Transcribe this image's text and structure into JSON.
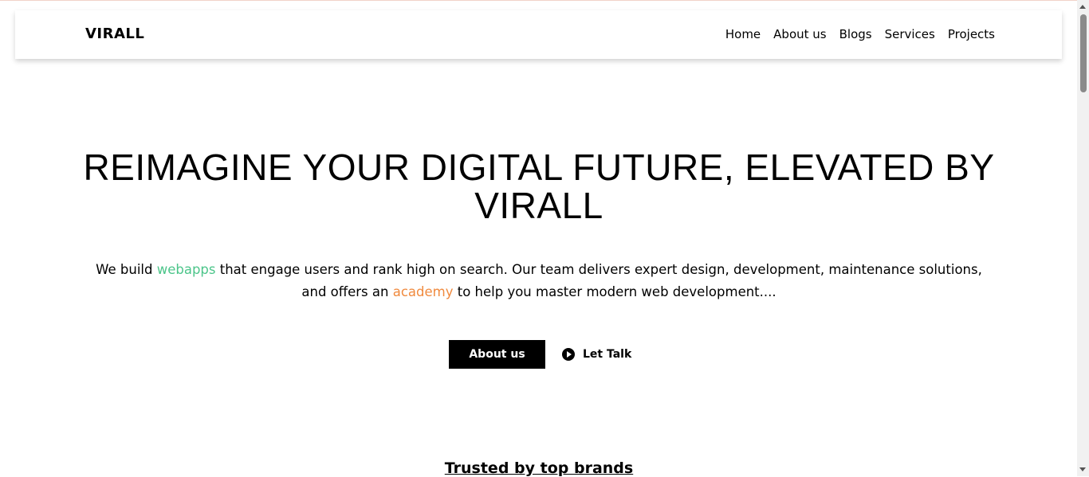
{
  "header": {
    "brand": "VIRALL",
    "menu": [
      "Home",
      "About us",
      "Blogs",
      "Services",
      "Projects"
    ]
  },
  "hero": {
    "title_line1": "REIMAGINE YOUR DIGITAL FUTURE, ELEVATED BY",
    "title_line2": "VIRALL",
    "desc_part1": "We build ",
    "desc_highlight1": "webapps",
    "desc_part2": " that engage users and rank high on search. Our team delivers expert design, development, maintenance solutions,",
    "desc_part3": "and offers an ",
    "desc_highlight2": "academy",
    "desc_part4": " to help you master modern web development....",
    "about_button": "About us",
    "talk_button": "Let Talk"
  },
  "trusted": {
    "title": "Trusted by top brands"
  },
  "colors": {
    "highlight_green": "#4cc58a",
    "highlight_orange": "#f08a3e",
    "button_bg": "#000000"
  }
}
